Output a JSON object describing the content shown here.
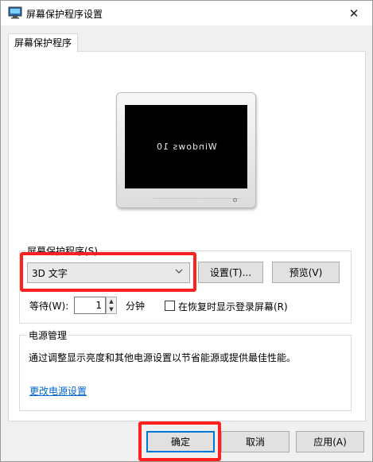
{
  "window": {
    "title": "屏幕保护程序设置",
    "close_glyph": "✕"
  },
  "tab": {
    "label": "屏幕保护程序"
  },
  "preview": {
    "screen_text": "Windows 10"
  },
  "saver_group": {
    "legend": "屏幕保护程序(S)",
    "selected": "3D 文字",
    "settings_label": "设置(T)...",
    "preview_label": "预览(V)",
    "wait_label": "等待(W):",
    "wait_value": "1",
    "unit_label": "分钟",
    "resume_label": "在恢复时显示登录屏幕(R)",
    "resume_checked": false
  },
  "power_group": {
    "legend": "电源管理",
    "description": "通过调整显示亮度和其他电源设置以节省能源或提供最佳性能。",
    "link_label": "更改电源设置"
  },
  "footer": {
    "ok_label": "确定",
    "cancel_label": "取消",
    "apply_label": "应用(A)"
  },
  "annotation_color": "#ff2020"
}
